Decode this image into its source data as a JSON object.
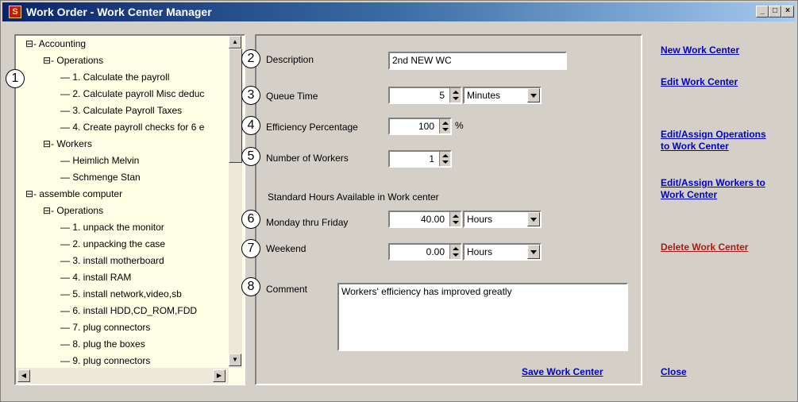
{
  "window": {
    "title": "Work Order - Work Center Manager",
    "app_icon": "S",
    "controls": [
      "_",
      "□",
      "×"
    ]
  },
  "tree": [
    {
      "text": "⊟- Accounting"
    },
    {
      "text": "⊟- Operations"
    },
    {
      "text": "— 1. Calculate the payroll"
    },
    {
      "text": "— 2. Calculate payroll Misc deduc"
    },
    {
      "text": "— 3. Calculate Payroll Taxes"
    },
    {
      "text": "— 4. Create payroll checks for 6 e"
    },
    {
      "text": "⊟- Workers"
    },
    {
      "text": "— Heimlich Melvin"
    },
    {
      "text": "— Schmenge Stan"
    },
    {
      "text": "⊟- assemble computer"
    },
    {
      "text": "⊟- Operations"
    },
    {
      "text": "— 1. unpack the monitor"
    },
    {
      "text": "— 2. unpacking the case"
    },
    {
      "text": "— 3. install motherboard"
    },
    {
      "text": "— 4. install RAM"
    },
    {
      "text": "— 5. install network,video,sb"
    },
    {
      "text": "— 6. install HDD,CD_ROM,FDD"
    },
    {
      "text": "— 7. plug connectors"
    },
    {
      "text": "— 8. plug the boxes"
    },
    {
      "text": "— 9. plug connectors"
    }
  ],
  "callouts": [
    "1",
    "2",
    "3",
    "4",
    "5",
    "6",
    "7",
    "8"
  ],
  "form": {
    "description_label": "Description",
    "description_value": "2nd NEW WC",
    "queue_label": "Queue Time",
    "queue_value": "5",
    "queue_unit": "Minutes",
    "efficiency_label": "Efficiency Percentage",
    "efficiency_value": "100",
    "percent_sign": "%",
    "workers_label": "Number of Workers",
    "workers_value": "1",
    "std_hours_heading": "Standard Hours Available in Work center",
    "weekday_label": "Monday thru Friday",
    "weekday_value": "40.00",
    "weekday_unit": "Hours",
    "weekend_label": "Weekend",
    "weekend_value": "0.00",
    "weekend_unit": "Hours",
    "comment_label": "Comment",
    "comment_value": "Workers' efficiency has improved greatly",
    "save_label": "Save Work Center"
  },
  "actions": {
    "new": "New Work Center",
    "edit": "Edit Work Center",
    "assign_ops_1": "Edit/Assign Operations",
    "assign_ops_2": "to Work Center",
    "assign_workers_1": "Edit/Assign Workers to",
    "assign_workers_2": "Work Center",
    "delete": "Delete Work Center",
    "close": "Close"
  },
  "colors": {
    "tree_bg": "#ffffe6",
    "link": "#0000cc",
    "delete_link": "#b01818"
  }
}
